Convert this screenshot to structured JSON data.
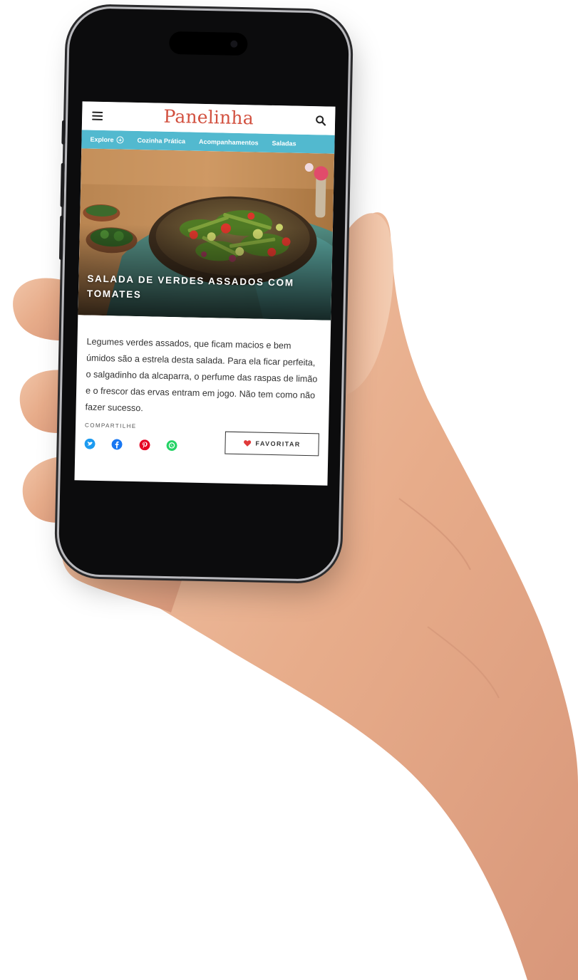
{
  "app": {
    "logo": "Panelinha"
  },
  "nav": {
    "items": [
      {
        "label": "Explore"
      },
      {
        "label": "Cozinha Prática"
      },
      {
        "label": "Acompanhamentos"
      },
      {
        "label": "Saladas"
      }
    ]
  },
  "recipe": {
    "title": "SALADA DE VERDES ASSADOS COM TOMATES",
    "description": "Legumes verdes assados, que ficam macios e bem úmidos são a estrela desta salada. Para ela ficar perfeita, o salgadinho da alcaparra, o perfume das raspas de limão e o frescor das ervas entram em jogo. Não tem como não fazer sucesso."
  },
  "share": {
    "label": "COMPARTILHE",
    "networks": [
      {
        "icon": "twitter-icon",
        "color": "#1d9bf0"
      },
      {
        "icon": "facebook-icon",
        "color": "#1877f2"
      },
      {
        "icon": "pinterest-icon",
        "color": "#e60023"
      },
      {
        "icon": "whatsapp-icon",
        "color": "#25d366"
      }
    ]
  },
  "actions": {
    "favorite_label": "FAVORITAR"
  },
  "colors": {
    "brand": "#d2503f",
    "nav_bg": "#52b9cf"
  }
}
